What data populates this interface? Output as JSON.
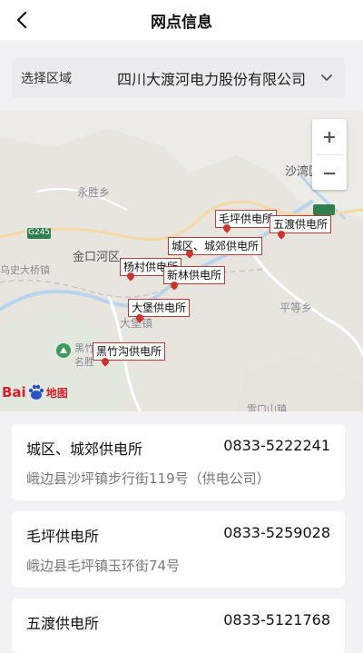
{
  "header": {
    "title": "网点信息"
  },
  "region": {
    "label": "选择区域",
    "value": "四川大渡河电力股份有限公司"
  },
  "map": {
    "places": {
      "yongsheng": "永胜乡",
      "jinkouhe": "金口河区",
      "dadu_bridge": "乌史大桥镇",
      "shawan": "沙湾区",
      "pingdeng": "平等乡",
      "dabao": "大堡镇",
      "heizhu": "黑竹",
      "minghe": "名胜",
      "g245": "G245",
      "bottom_town": "雪口山镇"
    },
    "markers": [
      {
        "label": "毛坪供电所"
      },
      {
        "label": "五渡供电所"
      },
      {
        "label": "城区、城郊供电所"
      },
      {
        "label": "杨村供电所"
      },
      {
        "label": "新林供电所"
      },
      {
        "label": "大堡供电所"
      },
      {
        "label": "黑竹沟供电所"
      }
    ],
    "logo": {
      "text1": "Bai",
      "text2": "地图"
    }
  },
  "stations": [
    {
      "name": "城区、城郊供电所",
      "phone": "0833-5222241",
      "address": "峨边县沙坪镇步行街119号（供电公司）"
    },
    {
      "name": "毛坪供电所",
      "phone": "0833-5259028",
      "address": "峨边县毛坪镇玉环街74号"
    },
    {
      "name": "五渡供电所",
      "phone": "0833-5121768",
      "address": ""
    }
  ],
  "colors": {
    "marker_border": "#b83b3b",
    "pin": "#c8362e",
    "page_bg": "#f2f2f4"
  }
}
